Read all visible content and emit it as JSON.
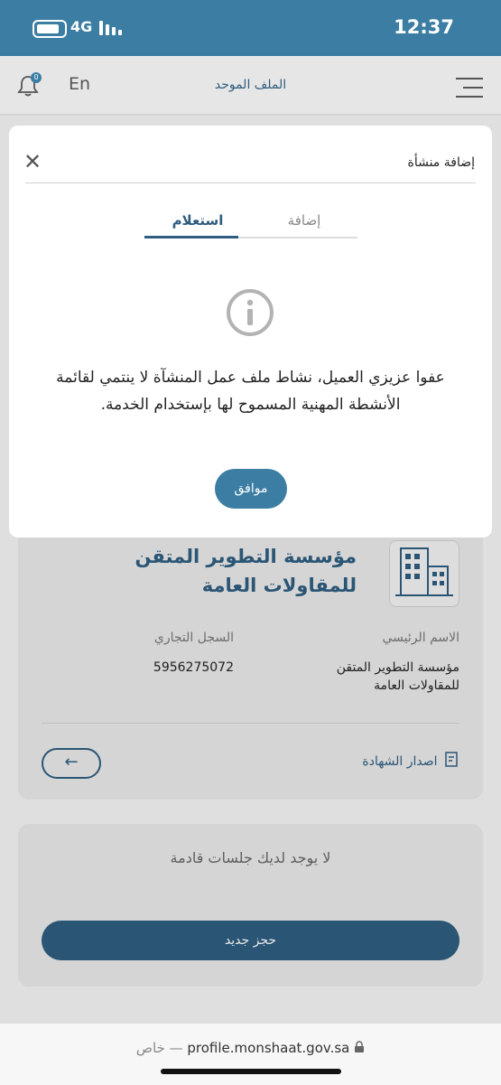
{
  "status_bar": {
    "time": "12:37",
    "network": "4G"
  },
  "app_bar": {
    "title": "الملف الموحد",
    "language_label": "En",
    "notification_count": "0"
  },
  "background": {
    "company_name": "مؤسسة التطوير المتقن للمقاولات العامة",
    "main_name_label": "الاسم الرئيسي",
    "main_name_value": "مؤسسة التطوير المتقن للمقاولات العامة",
    "cr_label": "السجل التجاري",
    "cr_value": "5956275072",
    "issue_certificate_label": "اصدار الشهادة",
    "back_arrow": "←",
    "no_sessions_text": "لا يوجد لديك جلسات قادمة",
    "new_booking_label": "حجز جديد"
  },
  "modal": {
    "title": "إضافة منشأة",
    "close_symbol": "✕",
    "tabs": [
      {
        "label": "استعلام",
        "active": true
      },
      {
        "label": "إضافة",
        "active": false
      }
    ],
    "message": "عفوا عزيزي العميل، نشاط ملف عمل المنشآة لا ينتمي لقائمة الأنشطة المهنية المسموح لها بإستخدام الخدمة.",
    "ok_label": "موافق"
  },
  "browser": {
    "domain": "profile.monshaat.gov.sa",
    "privacy_label": "خاص —"
  },
  "colors": {
    "brand": "#2e5d7f",
    "status_bar": "#3b7da3"
  },
  "icons": [
    "battery-icon",
    "signal-icon",
    "bell-icon",
    "hamburger-menu-icon",
    "building-icon",
    "certificate-icon",
    "info-icon",
    "close-icon",
    "lock-icon"
  ]
}
